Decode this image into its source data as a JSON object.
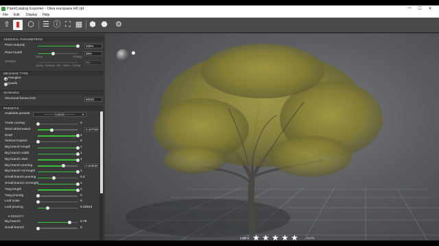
{
  "window": {
    "title": "PlantCatalog Exporter - Olea europaea HD.tpf",
    "controls": [
      "—",
      "☐",
      "✕"
    ]
  },
  "menu": [
    "File",
    "Edit",
    "Display",
    "Help"
  ],
  "toolbar": {
    "icons": [
      "home-arrow-icon",
      "plant-icon",
      "cube-icon",
      "list-icon",
      "info-icon",
      "frame-icon",
      "grid-icon",
      "cubes-icon",
      "cube-settings-icon",
      "gears-icon"
    ]
  },
  "general": {
    "header": "GENERAL PARAMETERS",
    "plant_maturity": {
      "label": "Plant maturity",
      "value": "100%",
      "level": 1.0
    },
    "plant_health": {
      "label": "Plant health",
      "value": "38%",
      "level": 0.38
    },
    "health_ticks": [
      "Dying",
      "Thriving"
    ],
    "season": {
      "label": "Season",
      "value": "0%"
    },
    "season_ticks": [
      "Spring",
      "Summer",
      "Fall",
      "Winter",
      "Spring"
    ]
  },
  "meshing": {
    "header": "MESHING TYPE",
    "options": [
      "Triangles",
      "Quads"
    ],
    "selected": "Triangles"
  },
  "skinning": {
    "header": "SKINNING",
    "label": "Structural bones limit",
    "value": "50032"
  },
  "presets": {
    "header": "PRESETS",
    "available_label": "Available presets",
    "selected": "--------- Custom ---------",
    "params": [
      {
        "label": "Trunk curving",
        "value": "0",
        "level": 0.0
      },
      {
        "label": "Wind deformation",
        "value": "0.347826",
        "level": 0.35,
        "boxed": true
      },
      {
        "label": "Snarl",
        "value": "1",
        "level": 1.0
      },
      {
        "label": "Vertical tropism",
        "value": "0",
        "level": 0.0
      },
      {
        "label": "Big branch length",
        "value": "1",
        "level": 1.0
      },
      {
        "label": "Big branch width",
        "value": "1",
        "level": 1.0
      },
      {
        "label": "Big branch start",
        "value": "1",
        "level": 1.0
      },
      {
        "label": "Big branch pruning",
        "value": "0.626087",
        "level": 0.63,
        "boxed": true
      },
      {
        "label": "Big branch rot length",
        "value": "1",
        "level": 1.0
      },
      {
        "label": "Small branch pruning",
        "value": "0.4",
        "level": 0.4
      },
      {
        "label": "Small branch rot length",
        "value": "1",
        "level": 1.0
      },
      {
        "label": "Twig length",
        "value": "1",
        "level": 1.0
      },
      {
        "label": "Twig pruning",
        "value": "0",
        "level": 0.0
      },
      {
        "label": "Leaf scale",
        "value": "0",
        "level": 0.0
      },
      {
        "label": "Leaf pruning",
        "value": "0.23913",
        "level": 0.24
      }
    ]
  },
  "density": {
    "header": "DENSITY",
    "params": [
      {
        "label": "Big branch",
        "value": "0.79",
        "level": 0.79
      },
      {
        "label": "Small branch",
        "value": "0",
        "level": 0.0
      }
    ]
  },
  "viewport": {
    "lod_label": "LOD 0",
    "stars": 5,
    "auto_label": "AUTO",
    "colors": {
      "foliage": "#8f8a3a",
      "trunk": "#4a4644",
      "grid": "#9aa0a6"
    }
  }
}
